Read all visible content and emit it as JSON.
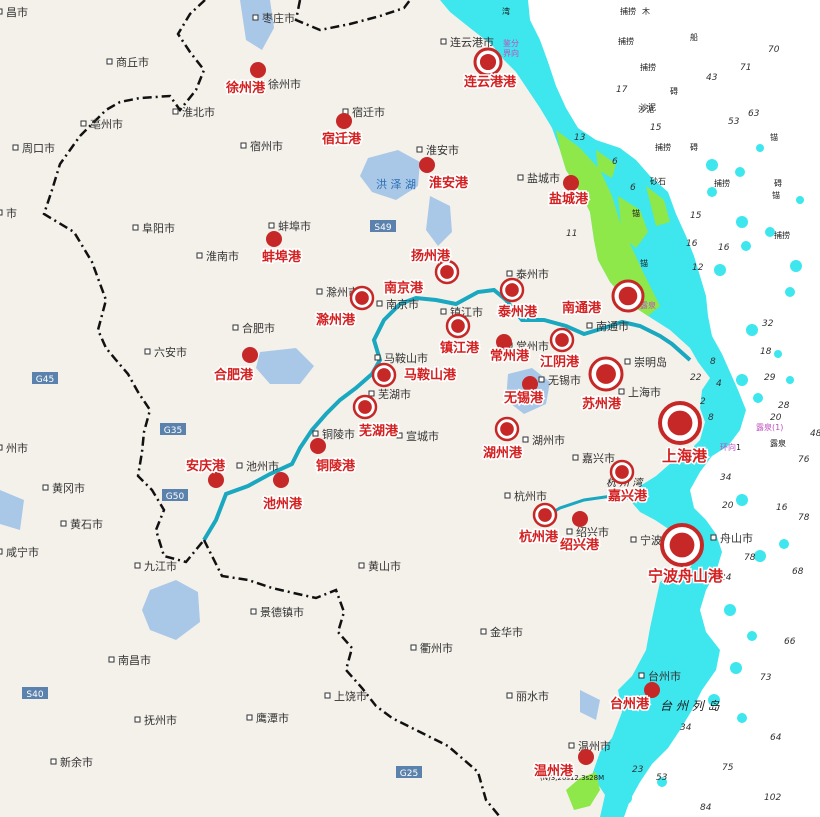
{
  "cities": [
    {
      "id": "zaozhuang",
      "label": "枣庄市"
    },
    {
      "id": "shangqiu",
      "label": "商丘市"
    },
    {
      "id": "xuzhou",
      "label": "徐州市"
    },
    {
      "id": "huaibei",
      "label": "淮北市"
    },
    {
      "id": "bozhou",
      "label": "亳州市"
    },
    {
      "id": "suqian",
      "label": "宿迁市"
    },
    {
      "id": "zhoukou",
      "label": "周口市"
    },
    {
      "id": "suzhou-ah",
      "label": "宿州市"
    },
    {
      "id": "huaian",
      "label": "淮安市"
    },
    {
      "id": "lianyungang",
      "label": "连云港市"
    },
    {
      "id": "yancheng",
      "label": "盐城市"
    },
    {
      "id": "fuyang",
      "label": "阜阳市"
    },
    {
      "id": "bengbu",
      "label": "蚌埠市"
    },
    {
      "id": "huainan",
      "label": "淮南市"
    },
    {
      "id": "taizhou-js",
      "label": "泰州市"
    },
    {
      "id": "chuzhou",
      "label": "滁州市"
    },
    {
      "id": "nanjing",
      "label": "南京市"
    },
    {
      "id": "zhenjiang",
      "label": "镇江市"
    },
    {
      "id": "nantong",
      "label": "南通市"
    },
    {
      "id": "hefei",
      "label": "合肥市"
    },
    {
      "id": "luan",
      "label": "六安市"
    },
    {
      "id": "changzhou",
      "label": "常州市"
    },
    {
      "id": "maanshan",
      "label": "马鞍山市"
    },
    {
      "id": "wuxi",
      "label": "无锡市"
    },
    {
      "id": "chongmingdao",
      "label": "崇明岛"
    },
    {
      "id": "shanghai",
      "label": "上海市"
    },
    {
      "id": "wuhu",
      "label": "芜湖市"
    },
    {
      "id": "tongling",
      "label": "铜陵市"
    },
    {
      "id": "xuancheng",
      "label": "宣城市"
    },
    {
      "id": "huzhou",
      "label": "湖州市"
    },
    {
      "id": "jiaxing",
      "label": "嘉兴市"
    },
    {
      "id": "chizhou",
      "label": "池州市"
    },
    {
      "id": "huanggang",
      "label": "黄冈市"
    },
    {
      "id": "huangshi",
      "label": "黄石市"
    },
    {
      "id": "hangzhou",
      "label": "杭州市"
    },
    {
      "id": "shaoxing",
      "label": "绍兴市"
    },
    {
      "id": "ningbo",
      "label": "宁波市"
    },
    {
      "id": "zhoushan",
      "label": "舟山市"
    },
    {
      "id": "xianning",
      "label": "咸宁市"
    },
    {
      "id": "jiujiang",
      "label": "九江市"
    },
    {
      "id": "huangshan",
      "label": "黄山市"
    },
    {
      "id": "jingdezhen",
      "label": "景德镇市"
    },
    {
      "id": "jinhua",
      "label": "金华市"
    },
    {
      "id": "nanchang",
      "label": "南昌市"
    },
    {
      "id": "quzhou",
      "label": "衢州市"
    },
    {
      "id": "taizhou-zj",
      "label": "台州市"
    },
    {
      "id": "lishui",
      "label": "丽水市"
    },
    {
      "id": "shangrao",
      "label": "上饶市"
    },
    {
      "id": "yingtan",
      "label": "鹰潭市"
    },
    {
      "id": "fuzhou-jx",
      "label": "抚州市"
    },
    {
      "id": "xinyu",
      "label": "新余市"
    },
    {
      "id": "wenzhou",
      "label": "温州市"
    },
    {
      "id": "xiangshi",
      "label": "昌市"
    },
    {
      "id": "shi-edge",
      "label": "市"
    },
    {
      "id": "zhou-edge",
      "label": "州市"
    }
  ],
  "ports": [
    {
      "id": "xuzhou-port",
      "label": "徐州港",
      "major": false
    },
    {
      "id": "lianyungang-port",
      "label": "连云港港",
      "major": true
    },
    {
      "id": "suqian-port",
      "label": "宿迁港",
      "major": false
    },
    {
      "id": "huaian-port",
      "label": "淮安港",
      "major": false
    },
    {
      "id": "yancheng-port",
      "label": "盐城港",
      "major": false
    },
    {
      "id": "bengbu-port",
      "label": "蚌埠港",
      "major": false
    },
    {
      "id": "yangzhou-port",
      "label": "扬州港",
      "major": true
    },
    {
      "id": "taizhou-port",
      "label": "泰州港",
      "major": true
    },
    {
      "id": "nantong-port",
      "label": "南通港",
      "major": true
    },
    {
      "id": "nanjing-port",
      "label": "南京港",
      "major": true
    },
    {
      "id": "chuzhou-port",
      "label": "滁州港",
      "major": false
    },
    {
      "id": "zhenjiang-port",
      "label": "镇江港",
      "major": true
    },
    {
      "id": "changzhou-port",
      "label": "常州港",
      "major": false
    },
    {
      "id": "jiangyin-port",
      "label": "江阴港",
      "major": true
    },
    {
      "id": "hefei-port",
      "label": "合肥港",
      "major": false
    },
    {
      "id": "maanshan-port",
      "label": "马鞍山港",
      "major": true
    },
    {
      "id": "suzhou-port",
      "label": "苏州港",
      "major": true
    },
    {
      "id": "wuxi-port",
      "label": "无锡港",
      "major": false
    },
    {
      "id": "wuhu-port",
      "label": "芜湖港",
      "major": true
    },
    {
      "id": "shanghai-port",
      "label": "上海港",
      "major": true
    },
    {
      "id": "tongling-port",
      "label": "铜陵港",
      "major": false
    },
    {
      "id": "huzhou-port",
      "label": "湖州港",
      "major": true
    },
    {
      "id": "anqing-port",
      "label": "安庆港",
      "major": false
    },
    {
      "id": "chizhou-port",
      "label": "池州港",
      "major": false
    },
    {
      "id": "jiaxing-port",
      "label": "嘉兴港",
      "major": true
    },
    {
      "id": "hangzhou-port",
      "label": "杭州港",
      "major": true
    },
    {
      "id": "shaoxing-port",
      "label": "绍兴港",
      "major": false
    },
    {
      "id": "ningbo-zhoushan-port",
      "label": "宁波舟山港",
      "major": true
    },
    {
      "id": "taizhou-zj-port",
      "label": "台州港",
      "major": false
    },
    {
      "id": "wenzhou-port",
      "label": "温州港",
      "major": false
    }
  ],
  "highways": [
    "S49",
    "G45",
    "G35",
    "G50",
    "S40",
    "G25"
  ],
  "lakes": [
    {
      "id": "hongze",
      "label": "洪 泽 湖"
    }
  ],
  "sea_labels": {
    "bay_top": "湾",
    "fenjie": "鉴分",
    "fenjie2": "界向",
    "zhoushan_isles": "台  州  列  岛",
    "hangzhou_bay": "杭  州  湾",
    "wenzhou_note": "(N)3,20s12.3s28M"
  },
  "seamarks": [
    "捕捞",
    "木",
    "捕捞",
    "船",
    "捕捞",
    "碍",
    "沙泥",
    "捕捞",
    "碍",
    "砂石",
    "锚",
    "捕捞",
    "露泉",
    "锚",
    "露泉(1)",
    "露泉",
    "环向",
    "1",
    "锚",
    "碍",
    "捕捞",
    "锚",
    "沙泥"
  ],
  "depths": [
    "70",
    "17",
    "43",
    "71",
    "63",
    "53",
    "15",
    "6",
    "13",
    "11",
    "15",
    "16",
    "16",
    "6",
    "12",
    "32",
    "18",
    "22",
    "29",
    "28",
    "20",
    "48",
    "76",
    "34",
    "20",
    "16",
    "78",
    "68",
    "66",
    "73",
    "64",
    "34",
    "75",
    "102",
    "84",
    "53",
    "78",
    "23",
    "24",
    "2",
    "8",
    "8",
    "4"
  ],
  "colors": {
    "land": "#f4f1ea",
    "sea": "#ffffff",
    "shallow": "#3ee6ee",
    "tidal": "#8fe84a",
    "river": "#1aa7c0",
    "port": "#c62828",
    "port_text": "#d42020",
    "border": "#111111",
    "highway": "#5b82ad"
  }
}
